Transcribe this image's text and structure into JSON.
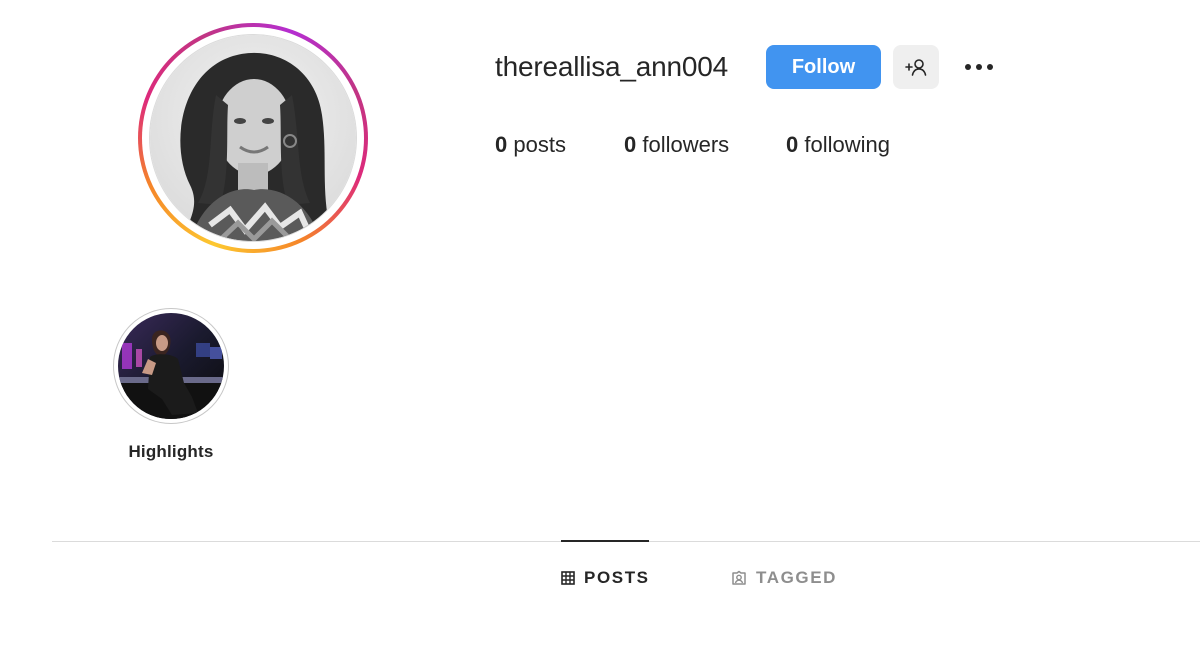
{
  "profile": {
    "username": "thereallisa_ann004",
    "follow_label": "Follow",
    "add_user_icon": "add-user-icon",
    "more_icon": "more-options-icon"
  },
  "stats": {
    "posts_count": "0",
    "posts_label": "posts",
    "followers_count": "0",
    "followers_label": "followers",
    "following_count": "0",
    "following_label": "following"
  },
  "highlights": [
    {
      "label": "Highlights"
    }
  ],
  "tabs": [
    {
      "label": "POSTS",
      "icon": "grid-icon",
      "active": true
    },
    {
      "label": "TAGGED",
      "icon": "tagged-icon",
      "active": false
    }
  ],
  "colors": {
    "follow_button": "#4194f0",
    "text_primary": "#262626",
    "text_muted": "#8e8e8e",
    "secondary_button": "#efefef"
  }
}
